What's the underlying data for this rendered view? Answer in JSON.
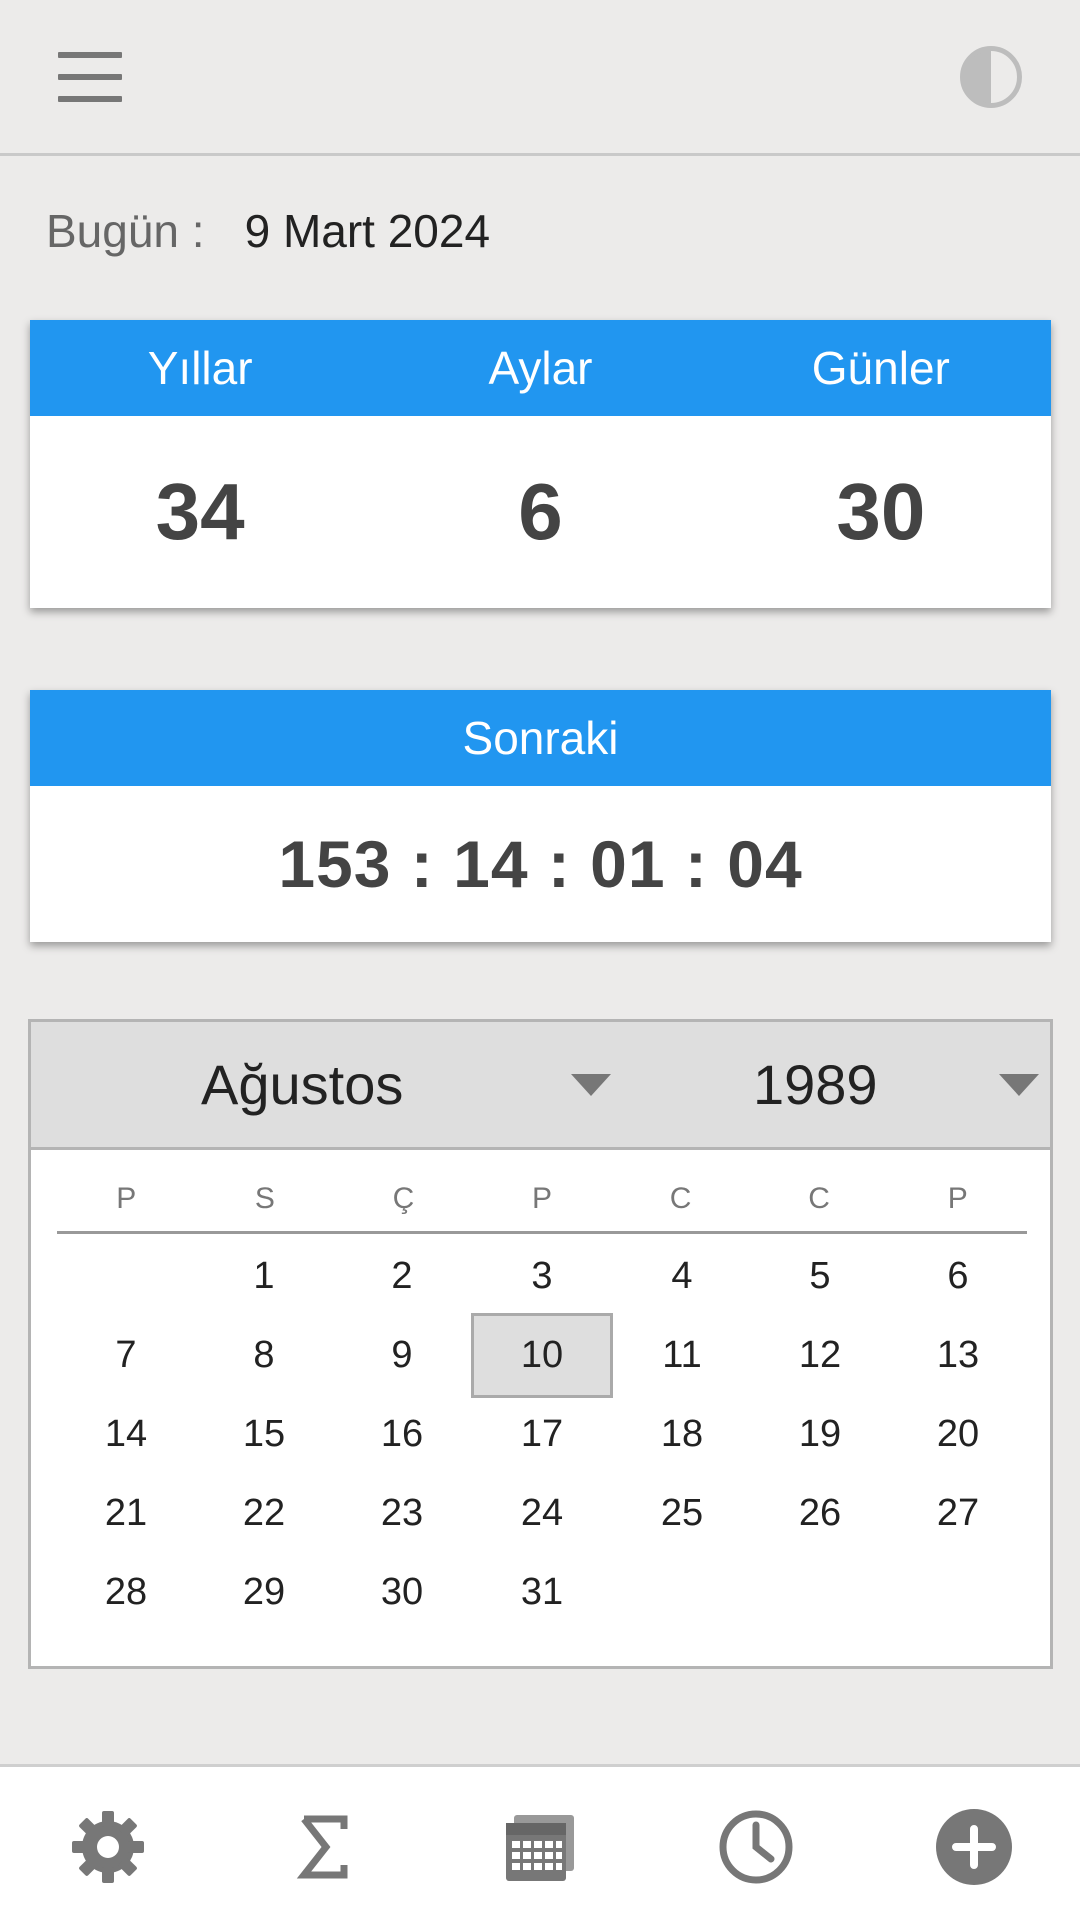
{
  "today": {
    "label": "Bugün :",
    "value": "9 Mart 2024"
  },
  "age": {
    "headers": [
      "Yıllar",
      "Aylar",
      "Günler"
    ],
    "values": [
      "34",
      "6",
      "30"
    ]
  },
  "next": {
    "title": "Sonraki",
    "countdown": "153 : 14 : 01 : 04"
  },
  "calendar": {
    "month": "Ağustos",
    "year": "1989",
    "weekdays": [
      "P",
      "S",
      "Ç",
      "P",
      "C",
      "C",
      "P"
    ],
    "days": [
      "",
      "1",
      "2",
      "3",
      "4",
      "5",
      "6",
      "7",
      "8",
      "9",
      "10",
      "11",
      "12",
      "13",
      "14",
      "15",
      "16",
      "17",
      "18",
      "19",
      "20",
      "21",
      "22",
      "23",
      "24",
      "25",
      "26",
      "27",
      "28",
      "29",
      "30",
      "31",
      "",
      "",
      ""
    ],
    "selected_day": "10"
  },
  "icons": {
    "menu": "hamburger-menu-icon",
    "theme": "contrast-icon",
    "nav": [
      "gear-icon",
      "sigma-icon",
      "calendar-icon",
      "clock-icon",
      "plus-icon"
    ]
  },
  "colors": {
    "accent": "#2196f0",
    "background": "#ecebea",
    "icon": "#777777"
  }
}
